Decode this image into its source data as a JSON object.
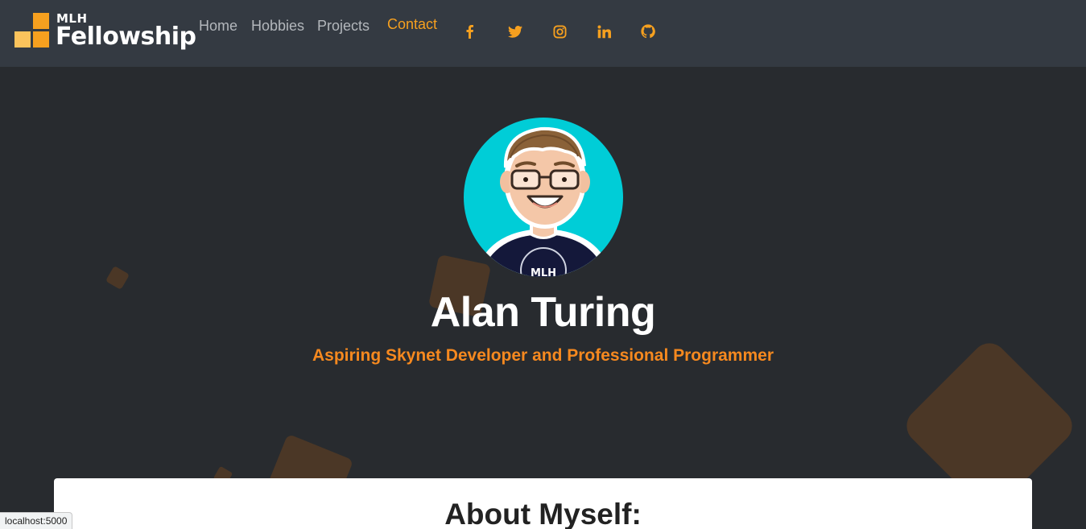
{
  "brand": {
    "top": "MLH",
    "name": "Fellowship"
  },
  "nav": {
    "links": [
      {
        "label": "Home"
      },
      {
        "label": "Hobbies"
      },
      {
        "label": "Projects"
      },
      {
        "label": "Contact"
      }
    ]
  },
  "social": [
    {
      "icon": "facebook-icon"
    },
    {
      "icon": "twitter-icon"
    },
    {
      "icon": "instagram-icon"
    },
    {
      "icon": "linkedin-icon"
    },
    {
      "icon": "github-icon"
    }
  ],
  "hero": {
    "name": "Alan Turing",
    "tagline": "Aspiring Skynet Developer and Professional Programmer",
    "avatar_shirt_text": "MLH"
  },
  "about": {
    "title": "About Myself:"
  },
  "status_bar": {
    "url": "localhost:5000"
  },
  "colors": {
    "navbar": "#343a42",
    "background": "#282b2f",
    "accent": "#f6a01f",
    "tagline": "#f6891f",
    "shape": "#4b3726",
    "avatar_bg": "#00cdd7"
  }
}
